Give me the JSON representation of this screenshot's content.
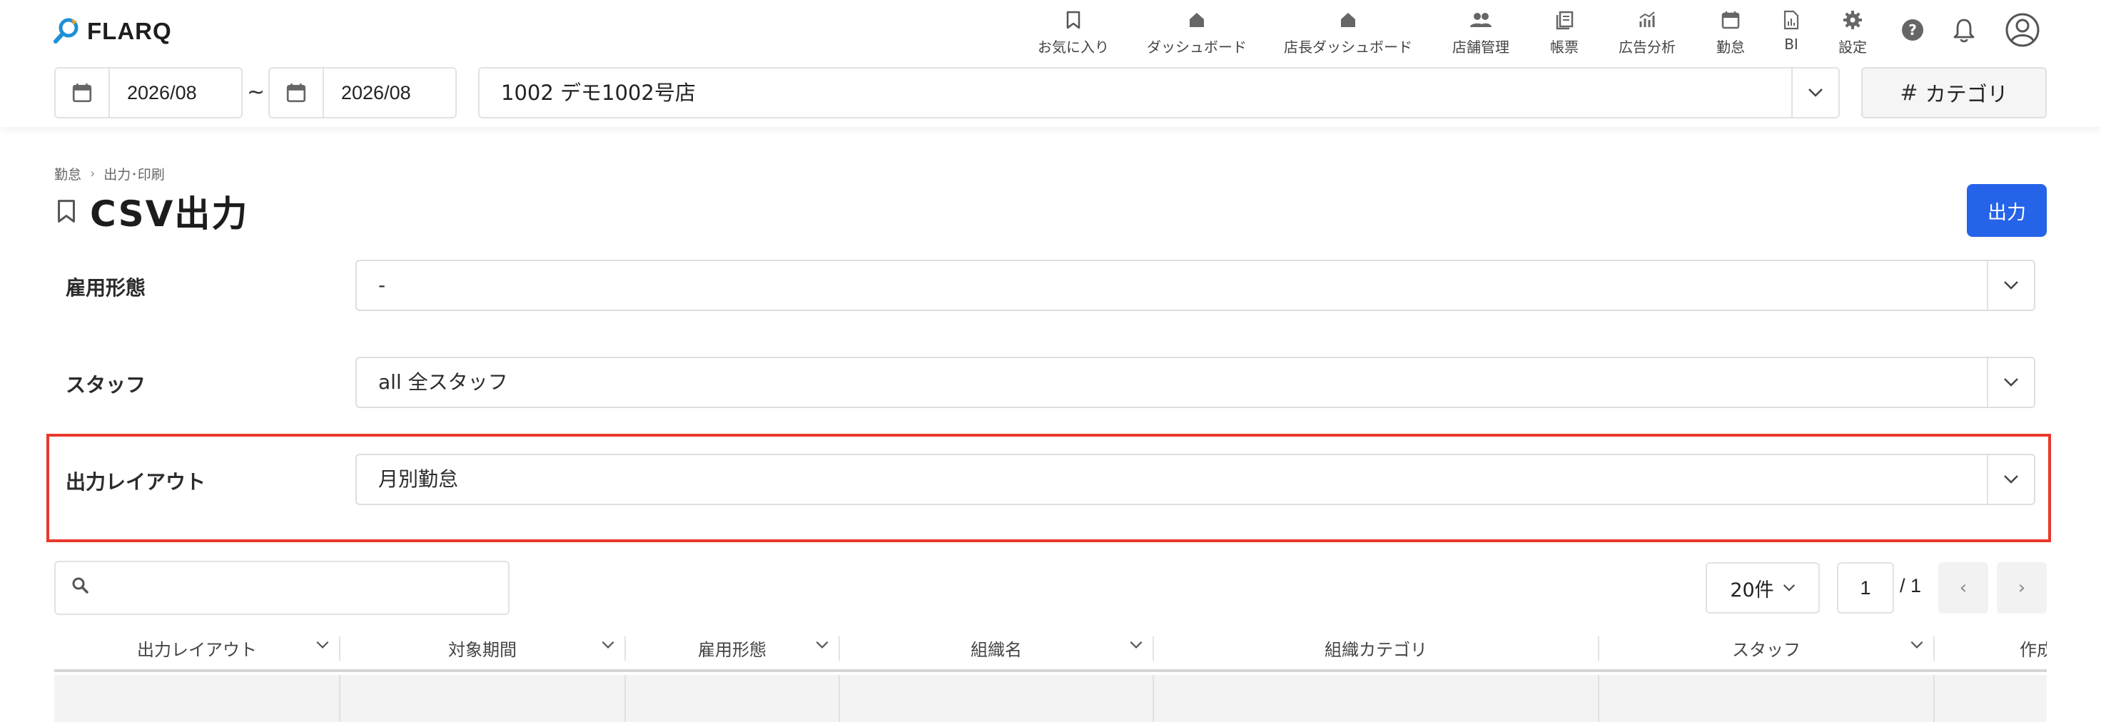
{
  "app": {
    "logo_text": "FLARQ"
  },
  "nav": {
    "items": [
      {
        "label": "お気に入り",
        "icon": "bookmark-icon"
      },
      {
        "label": "ダッシュボード",
        "icon": "home-icon"
      },
      {
        "label": "店長ダッシュボード",
        "icon": "home-icon"
      },
      {
        "label": "店舗管理",
        "icon": "people-icon"
      },
      {
        "label": "帳票",
        "icon": "report-icon"
      },
      {
        "label": "広告分析",
        "icon": "analytics-icon"
      },
      {
        "label": "勤怠",
        "icon": "calendar-icon"
      },
      {
        "label": "BI",
        "icon": "bi-file-icon"
      },
      {
        "label": "設定",
        "icon": "gear-icon"
      }
    ],
    "help_icon": "help-icon",
    "notification_icon": "bell-icon",
    "account_icon": "account-icon"
  },
  "filters": {
    "date_from": "2026/08",
    "date_separator": "~",
    "date_to": "2026/08",
    "store": "1002 デモ1002号店",
    "category_button": "カテゴリ"
  },
  "breadcrumb": [
    "勤怠",
    "出力･印刷"
  ],
  "page": {
    "title": "CSV出力",
    "output_button": "出力"
  },
  "form": {
    "employment_type": {
      "label": "雇用形態",
      "value": "-"
    },
    "staff": {
      "label": "スタッフ",
      "value": "all 全スタッフ"
    },
    "output_layout": {
      "label": "出力レイアウト",
      "value": "月別勤怠"
    }
  },
  "table_toolbar": {
    "search_placeholder": "",
    "per_page": "20件",
    "current_page": "1",
    "total_pages": "/ 1",
    "prev": "‹",
    "next": "›"
  },
  "table": {
    "columns": [
      "出力レイアウト",
      "対象期間",
      "雇用形態",
      "組織名",
      "組織カテゴリ",
      "スタッフ",
      "作成"
    ]
  },
  "colors": {
    "primary_button": "#2563e8",
    "highlight_border": "#e8392c",
    "logo_accent": "#1f8fd6"
  }
}
